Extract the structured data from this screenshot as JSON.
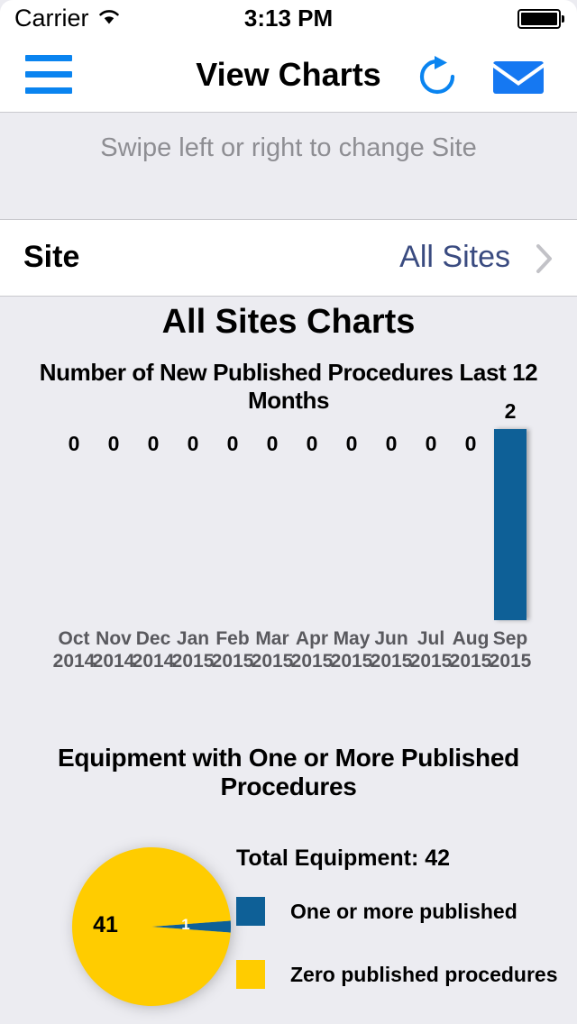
{
  "status_bar": {
    "carrier": "Carrier",
    "wifi_icon": "wifi-icon",
    "time": "3:13 PM",
    "battery_icon": "battery-full-icon"
  },
  "nav_bar": {
    "menu_icon": "hamburger-menu-icon",
    "title": "View Charts",
    "refresh_icon": "refresh-icon",
    "mail_icon": "mail-icon",
    "accent_color": "#0A84F0"
  },
  "banner": {
    "text": "Swipe left or right to change Site"
  },
  "site_row": {
    "label": "Site",
    "value": "All Sites",
    "chevron_icon": "chevron-right-icon",
    "value_color": "#3A4B80"
  },
  "charts_heading": "All Sites Charts",
  "chart_data": [
    {
      "type": "bar",
      "title": "Number of New Published Procedures Last 12 Months",
      "categories": [
        "Oct\n2014",
        "Nov\n2014",
        "Dec\n2014",
        "Jan\n2015",
        "Feb\n2015",
        "Mar\n2015",
        "Apr\n2015",
        "May\n2015",
        "Jun\n2015",
        "Jul\n2015",
        "Aug\n2015",
        "Sep\n2015"
      ],
      "category_months": [
        "Oct",
        "Nov",
        "Dec",
        "Jan",
        "Feb",
        "Mar",
        "Apr",
        "May",
        "Jun",
        "Jul",
        "Aug",
        "Sep"
      ],
      "category_years": [
        "2014",
        "2014",
        "2014",
        "2015",
        "2015",
        "2015",
        "2015",
        "2015",
        "2015",
        "2015",
        "2015",
        "2015"
      ],
      "values": [
        0,
        0,
        0,
        0,
        0,
        0,
        0,
        0,
        0,
        0,
        0,
        2
      ],
      "xlabel": "",
      "ylabel": "",
      "ylim": [
        0,
        2
      ],
      "grid": false,
      "legend": false,
      "bar_color": "#0E6097",
      "label_color": "#000000",
      "tick_color": "#59595E"
    },
    {
      "type": "pie",
      "title": "Equipment with One or More Published Procedures",
      "total_label": "Total Equipment: 42",
      "total": 42,
      "labels": [
        "One or more published",
        "Zero published procedures"
      ],
      "values": [
        1,
        41
      ],
      "colors": [
        "#0E6097",
        "#FFCC00"
      ],
      "slice_labels": [
        "1",
        "41"
      ],
      "legend": true,
      "legend_position": "right"
    }
  ]
}
